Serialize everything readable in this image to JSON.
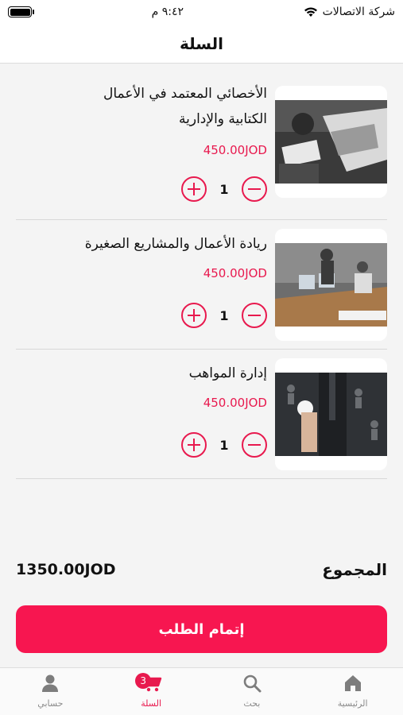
{
  "status_bar": {
    "carrier": "شركة الاتصالات",
    "time": "٩:٤٢ م"
  },
  "header": {
    "title": "السلة"
  },
  "currency_color": "#e8194e",
  "cart_items": [
    {
      "title": "الأخصائي المعتمد في الأعمال الكتابية والإدارية",
      "price": "450.00JOD",
      "quantity": "1",
      "image": "office-desk-photo"
    },
    {
      "title": "ريادة الأعمال والمشاريع الصغيرة",
      "price": "450.00JOD",
      "quantity": "1",
      "image": "meeting-room-photo"
    },
    {
      "title": "إدارة المواهب",
      "price": "450.00JOD",
      "quantity": "1",
      "image": "talent-touch-photo"
    }
  ],
  "summary": {
    "total_label": "المجموع",
    "total_value": "1350.00JOD"
  },
  "checkout_button": {
    "label": "إتمام الطلب",
    "color": "#f71650"
  },
  "tab_bar": {
    "tabs": [
      {
        "label": "الرئيسية",
        "icon": "home-icon"
      },
      {
        "label": "بحث",
        "icon": "search-icon"
      },
      {
        "label": "السلة",
        "icon": "cart-icon",
        "badge": "3",
        "active": true
      },
      {
        "label": "حسابي",
        "icon": "user-icon"
      }
    ]
  }
}
